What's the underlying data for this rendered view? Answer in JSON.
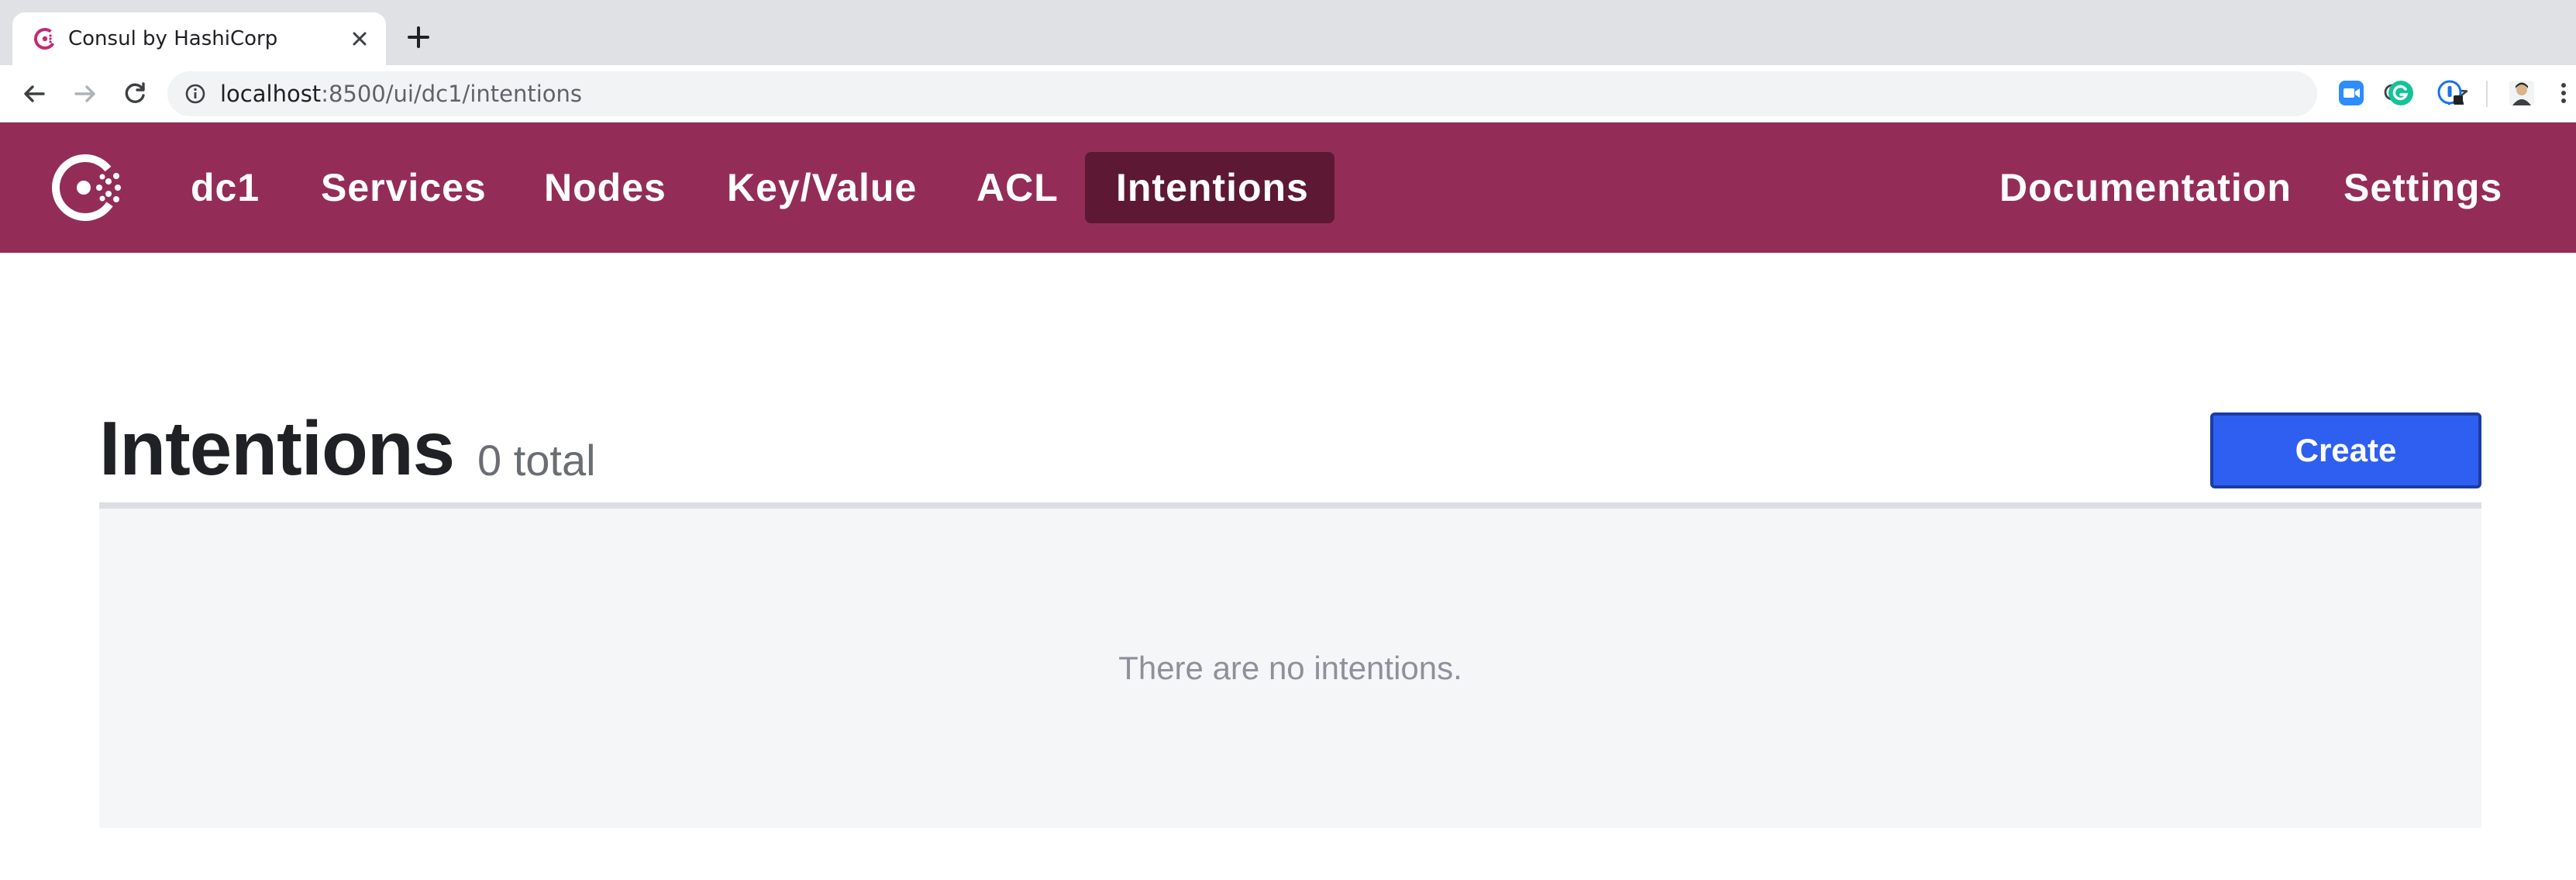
{
  "browser": {
    "tab_title": "Consul by HashiCorp",
    "url_host": "localhost",
    "url_rest": ":8500/ui/dc1/intentions"
  },
  "header": {
    "datacenter": "dc1",
    "nav": [
      {
        "label": "Services"
      },
      {
        "label": "Nodes"
      },
      {
        "label": "Key/Value"
      },
      {
        "label": "ACL"
      },
      {
        "label": "Intentions",
        "active": true
      }
    ],
    "right_nav": [
      {
        "label": "Documentation"
      },
      {
        "label": "Settings"
      }
    ],
    "brand_color": "#932d58",
    "active_color": "#5d1833"
  },
  "main": {
    "title": "Intentions",
    "count_text": "0 total",
    "create_label": "Create",
    "empty_message": "There are no intentions.",
    "accent_color": "#2e5ff0"
  },
  "icons": [
    "consul-favicon",
    "close-icon",
    "plus-icon",
    "back-icon",
    "forward-icon",
    "reload-icon",
    "info-icon",
    "zoom-icon",
    "star-icon",
    "zoom-meetings-icon",
    "grammarly-icon",
    "password-manager-icon",
    "profile-avatar-icon",
    "more-icon",
    "consul-logo-icon"
  ]
}
